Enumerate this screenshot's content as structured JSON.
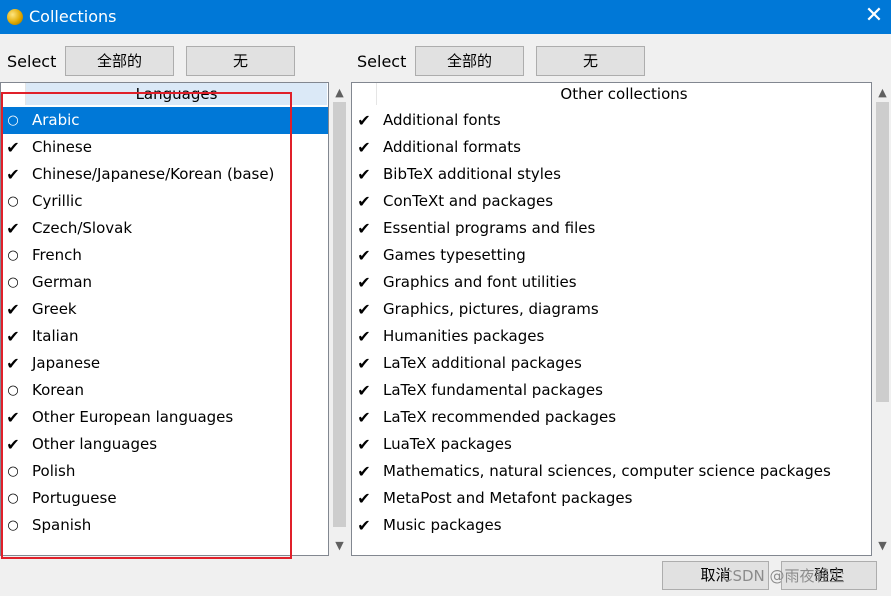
{
  "window": {
    "title": "Collections",
    "close_glyph": "✕"
  },
  "select_label": "Select",
  "select_all_label": "全部的",
  "select_none_label": "无",
  "languages": {
    "header": "Languages",
    "items": [
      {
        "label": "Arabic",
        "mark": "○",
        "checked": false,
        "selected": true
      },
      {
        "label": "Chinese",
        "mark": "✔",
        "checked": true
      },
      {
        "label": "Chinese/Japanese/Korean (base)",
        "mark": "✔",
        "checked": true
      },
      {
        "label": "Cyrillic",
        "mark": "○",
        "checked": false
      },
      {
        "label": "Czech/Slovak",
        "mark": "✔",
        "checked": true
      },
      {
        "label": "French",
        "mark": "○",
        "checked": false
      },
      {
        "label": "German",
        "mark": "○",
        "checked": false
      },
      {
        "label": "Greek",
        "mark": "✔",
        "checked": true
      },
      {
        "label": "Italian",
        "mark": "✔",
        "checked": true
      },
      {
        "label": "Japanese",
        "mark": "✔",
        "checked": true
      },
      {
        "label": "Korean",
        "mark": "○",
        "checked": false
      },
      {
        "label": "Other European languages",
        "mark": "✔",
        "checked": true
      },
      {
        "label": "Other languages",
        "mark": "✔",
        "checked": true
      },
      {
        "label": "Polish",
        "mark": "○",
        "checked": false
      },
      {
        "label": "Portuguese",
        "mark": "○",
        "checked": false
      },
      {
        "label": "Spanish",
        "mark": "○",
        "checked": false
      }
    ]
  },
  "other": {
    "header": "Other collections",
    "items": [
      {
        "label": "Additional fonts",
        "mark": "✔",
        "checked": true
      },
      {
        "label": "Additional formats",
        "mark": "✔",
        "checked": true
      },
      {
        "label": "BibTeX additional styles",
        "mark": "✔",
        "checked": true
      },
      {
        "label": "ConTeXt and packages",
        "mark": "✔",
        "checked": true
      },
      {
        "label": "Essential programs and files",
        "mark": "✔",
        "checked": true
      },
      {
        "label": "Games typesetting",
        "mark": "✔",
        "checked": true
      },
      {
        "label": "Graphics and font utilities",
        "mark": "✔",
        "checked": true
      },
      {
        "label": "Graphics, pictures, diagrams",
        "mark": "✔",
        "checked": true
      },
      {
        "label": "Humanities packages",
        "mark": "✔",
        "checked": true
      },
      {
        "label": "LaTeX additional packages",
        "mark": "✔",
        "checked": true
      },
      {
        "label": "LaTeX fundamental packages",
        "mark": "✔",
        "checked": true
      },
      {
        "label": "LaTeX recommended packages",
        "mark": "✔",
        "checked": true
      },
      {
        "label": "LuaTeX packages",
        "mark": "✔",
        "checked": true
      },
      {
        "label": "Mathematics, natural sciences, computer science packages",
        "mark": "✔",
        "checked": true
      },
      {
        "label": "MetaPost and Metafont packages",
        "mark": "✔",
        "checked": true
      },
      {
        "label": "Music packages",
        "mark": "✔",
        "checked": true
      }
    ]
  },
  "footer": {
    "cancel_label": "取消",
    "ok_label": "确定",
    "watermark": "CSDN @雨夜轻尘"
  },
  "colors": {
    "title_bar": "#0078d7",
    "selection": "#0078d7",
    "highlight_box": "#e0202a"
  },
  "icons": {
    "scroll_up": "▲",
    "scroll_down": "▼"
  }
}
